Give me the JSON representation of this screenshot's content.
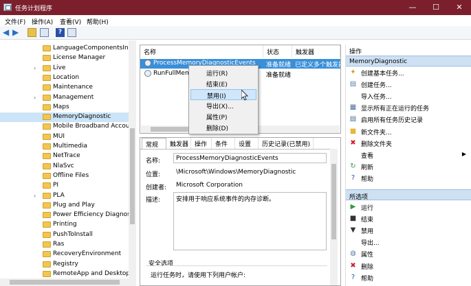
{
  "window": {
    "title": "任务计划程序",
    "minimize": "—",
    "maximize": "☐",
    "close": "✕"
  },
  "menu": [
    "文件(F)",
    "操作(A)",
    "查看(V)",
    "帮助(H)"
  ],
  "tree": {
    "items": [
      {
        "label": "LanguageComponentsInst",
        "chevron": false
      },
      {
        "label": "License Manager",
        "chevron": false
      },
      {
        "label": "Live",
        "chevron": true
      },
      {
        "label": "Location",
        "chevron": false
      },
      {
        "label": "Maintenance",
        "chevron": false
      },
      {
        "label": "Management",
        "chevron": true
      },
      {
        "label": "Maps",
        "chevron": false
      },
      {
        "label": "MemoryDiagnostic",
        "chevron": false,
        "selected": true
      },
      {
        "label": "Mobile Broadband Accou",
        "chevron": false
      },
      {
        "label": "MUI",
        "chevron": false
      },
      {
        "label": "Multimedia",
        "chevron": false
      },
      {
        "label": "NetTrace",
        "chevron": false
      },
      {
        "label": "NlaSvc",
        "chevron": false
      },
      {
        "label": "Offline Files",
        "chevron": false
      },
      {
        "label": "PI",
        "chevron": false
      },
      {
        "label": "PLA",
        "chevron": true
      },
      {
        "label": "Plug and Play",
        "chevron": false
      },
      {
        "label": "Power Efficiency Diagnost",
        "chevron": false
      },
      {
        "label": "Printing",
        "chevron": false
      },
      {
        "label": "PushToInstall",
        "chevron": false
      },
      {
        "label": "Ras",
        "chevron": false
      },
      {
        "label": "RecoveryEnvironment",
        "chevron": false
      },
      {
        "label": "Registry",
        "chevron": false
      },
      {
        "label": "RemoteApp and Desktop",
        "chevron": false
      }
    ]
  },
  "tasklist": {
    "columns": [
      "名称",
      "状态",
      "触发器"
    ],
    "rows": [
      {
        "name": "ProcessMemoryDiagnosticEvents",
        "status": "准备就绪",
        "trigger": "已定义多个触发器",
        "selected": true
      },
      {
        "name": "RunFullMemo",
        "status": "准备就绪",
        "trigger": "",
        "selected": false
      }
    ]
  },
  "context_menu": {
    "items": [
      {
        "label": "运行(R)",
        "highlighted": false
      },
      {
        "label": "结束(E)",
        "highlighted": false
      },
      {
        "label": "禁用(I)",
        "highlighted": true
      },
      {
        "label": "导出(X)...",
        "highlighted": false
      },
      {
        "label": "属性(P)",
        "highlighted": false
      },
      {
        "label": "删除(D)",
        "highlighted": false
      }
    ]
  },
  "details": {
    "tabs": [
      "常规",
      "触发器",
      "操作",
      "条件",
      "设置",
      "历史记录(已禁用)"
    ],
    "selected_tab": 0,
    "name_label": "名称:",
    "name_value": "ProcessMemoryDiagnosticEvents",
    "location_label": "位置:",
    "location_value": "\\Microsoft\\Windows\\MemoryDiagnostic",
    "author_label": "创建者:",
    "author_value": "Microsoft Corporation",
    "desc_label": "描述:",
    "desc_value": "安排用于响应系统事件的内存诊断。",
    "security_title": "安全选项",
    "security_text": "运行任务时，请使用下列用户帐户:"
  },
  "actions": {
    "header": "操作",
    "section1": "MemoryDiagnostic",
    "items1": [
      {
        "label": "创建基本任务...",
        "icon": "wand-icon",
        "glyph": "✦",
        "color": "#d89a1c"
      },
      {
        "label": "创建任务...",
        "icon": "task-icon",
        "glyph": "▤",
        "color": "#5a7fa8"
      },
      {
        "label": "导入任务...",
        "icon": "",
        "glyph": "",
        "color": "#000"
      },
      {
        "label": "显示所有正在运行的任务",
        "icon": "list-icon",
        "glyph": "▦",
        "color": "#4a6f9a"
      },
      {
        "label": "启用所有任务历史记录",
        "icon": "history-icon",
        "glyph": "▤",
        "color": "#4a6f9a"
      },
      {
        "label": "新文件夹...",
        "icon": "folder-icon",
        "glyph": "■",
        "color": "#e6b83a"
      },
      {
        "label": "删除文件夹",
        "icon": "delete-icon",
        "glyph": "✖",
        "color": "#d0202a"
      },
      {
        "label": "查看",
        "icon": "",
        "glyph": "",
        "color": "#000",
        "submenu": true
      },
      {
        "label": "刷新",
        "icon": "refresh-icon",
        "glyph": "↻",
        "color": "#2f9a3a"
      },
      {
        "label": "帮助",
        "icon": "help-icon",
        "glyph": "?",
        "color": "#2a4fa8"
      }
    ],
    "section2": "所选项",
    "items2": [
      {
        "label": "运行",
        "icon": "run-icon",
        "glyph": "▶",
        "color": "#2f9a3a"
      },
      {
        "label": "结束",
        "icon": "stop-icon",
        "glyph": "■",
        "color": "#333"
      },
      {
        "label": "禁用",
        "icon": "disable-icon",
        "glyph": "▼",
        "color": "#333"
      },
      {
        "label": "导出...",
        "icon": "",
        "glyph": "",
        "color": "#000"
      },
      {
        "label": "属性",
        "icon": "properties-icon",
        "glyph": "◍",
        "color": "#5a7fa8"
      },
      {
        "label": "删除",
        "icon": "delete-icon",
        "glyph": "✖",
        "color": "#d0202a"
      },
      {
        "label": "帮助",
        "icon": "help-icon",
        "glyph": "?",
        "color": "#2a4fa8"
      }
    ]
  },
  "colors": {
    "titlebar": "#7b1f2d",
    "selection": "#3a8fd8",
    "section_header": "#cde1f3"
  }
}
